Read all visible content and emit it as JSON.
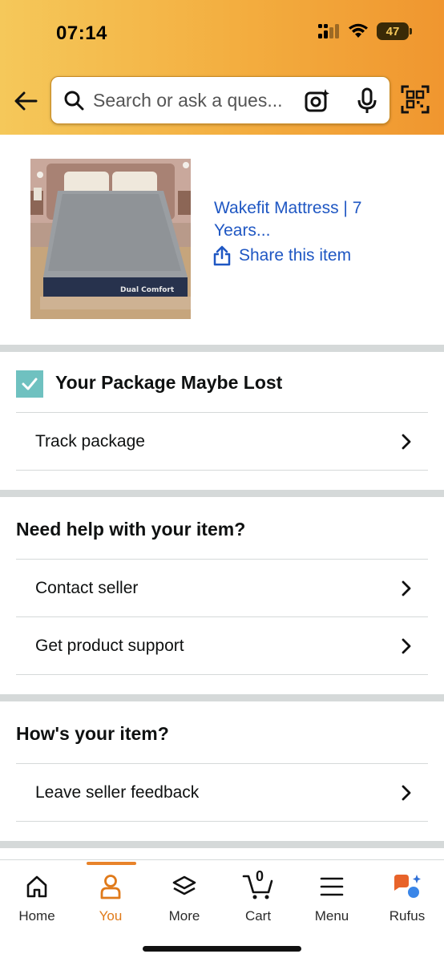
{
  "status_bar": {
    "time": "07:14",
    "battery": "47"
  },
  "search": {
    "placeholder": "Search or ask a ques..."
  },
  "product": {
    "title": "Wakefit Mattress | 7 Years...",
    "share_label": "Share this item",
    "image_brand_text": "Dual Comfort"
  },
  "package": {
    "title": "Your Package Maybe Lost",
    "track_label": "Track package"
  },
  "help": {
    "title": "Need help with your item?",
    "contact_label": "Contact seller",
    "support_label": "Get product support"
  },
  "review": {
    "title": "How's your item?",
    "feedback_label": "Leave seller feedback"
  },
  "nav": {
    "items": [
      {
        "label": "Home",
        "icon": "home-icon"
      },
      {
        "label": "You",
        "icon": "person-icon"
      },
      {
        "label": "More",
        "icon": "layers-icon"
      },
      {
        "label": "Cart",
        "icon": "cart-icon",
        "count": "0"
      },
      {
        "label": "Menu",
        "icon": "menu-icon"
      },
      {
        "label": "Rufus",
        "icon": "rufus-icon"
      }
    ],
    "active": "You"
  },
  "colors": {
    "link": "#1f57c3",
    "accent": "#e07a1a",
    "check": "#6fc1c0",
    "header_start": "#f5c85a",
    "header_end": "#f0962f"
  }
}
